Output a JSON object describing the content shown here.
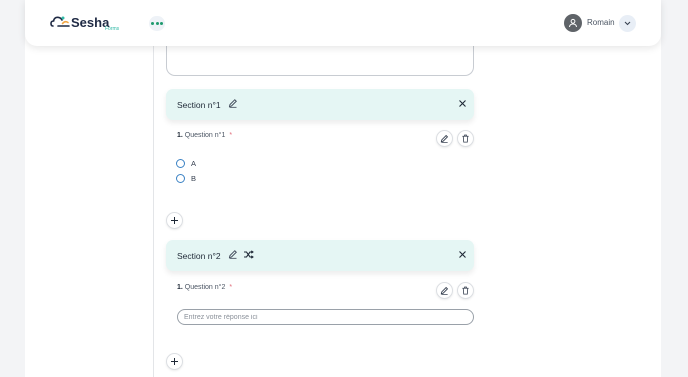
{
  "header": {
    "logo_text": "Sesha",
    "logo_sub": "Forms",
    "user_name": "Romain"
  },
  "sections": [
    {
      "title": "Section n°1",
      "question": {
        "number": "1.",
        "label": "Question n°1",
        "required_mark": "*",
        "type": "radio",
        "options": [
          "A",
          "B"
        ]
      }
    },
    {
      "title": "Section n°2",
      "question": {
        "number": "1.",
        "label": "Question n°2",
        "required_mark": "*",
        "type": "text",
        "placeholder": "Entrez votre réponse ici"
      }
    }
  ],
  "icons": {
    "menu": "dots-horizontal-icon",
    "user": "user-avatar-icon",
    "chevron": "chevron-down-icon",
    "edit": "pencil-icon",
    "delete": "trash-icon",
    "close": "close-icon",
    "shuffle": "shuffle-icon",
    "add": "plus-icon"
  },
  "colors": {
    "accent": "#1e9a6e",
    "section_bg": "#e5f6f4",
    "required": "#e06a78",
    "radio": "#3b82c4"
  }
}
